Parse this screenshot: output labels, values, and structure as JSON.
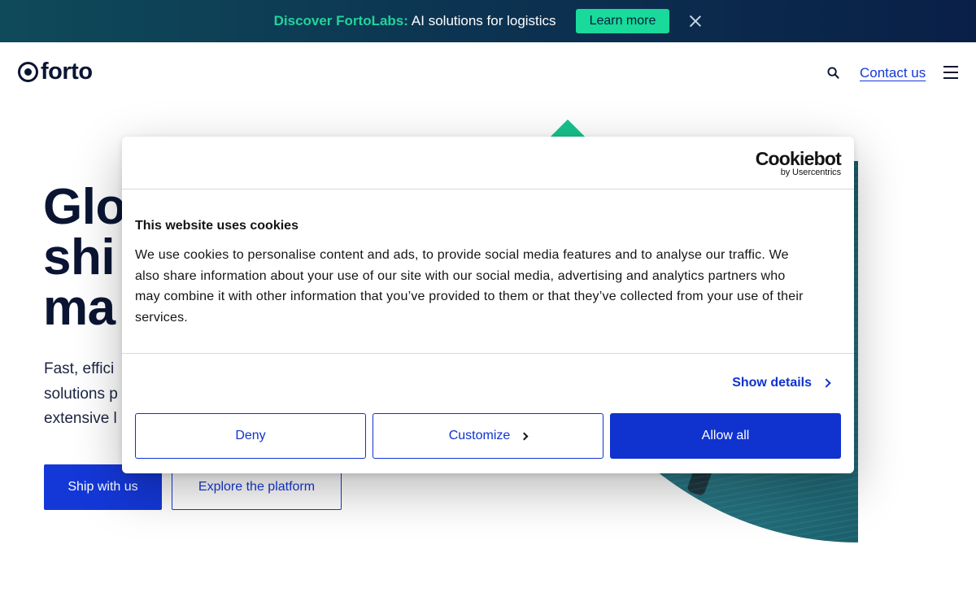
{
  "banner": {
    "brand": "Discover FortoLabs:",
    "text": "AI solutions for logistics",
    "cta": "Learn more",
    "close_icon": "close-icon"
  },
  "header": {
    "logo": "forto",
    "search_icon": "search-icon",
    "contact": "Contact us",
    "menu_icon": "hamburger-menu-icon"
  },
  "hero": {
    "title_lines": [
      "Glo",
      "shi",
      "ma"
    ],
    "subtitle_lines": [
      "Fast, effici",
      "solutions p",
      "extensive l"
    ],
    "primary_cta": "Ship with us",
    "secondary_cta": "Explore the platform"
  },
  "cookie_dialog": {
    "provider_logo": "Cookiebot",
    "provider_sub": "by Usercentrics",
    "title": "This website uses cookies",
    "body_lines": [
      "We use cookies to personalise content and ads, to provide social media features and to analyse our traffic. We",
      "also share information about your use of our site with our social media, advertising and analytics partners who",
      "may combine it with other information that you’ve provided to them or that they’ve collected from your use of their",
      "services."
    ],
    "show_details": "Show details",
    "deny": "Deny",
    "customize": "Customize",
    "allow_all": "Allow all"
  },
  "colors": {
    "accent": "#1438d8",
    "brand_green": "#19d99b",
    "navy": "#0b1533"
  }
}
